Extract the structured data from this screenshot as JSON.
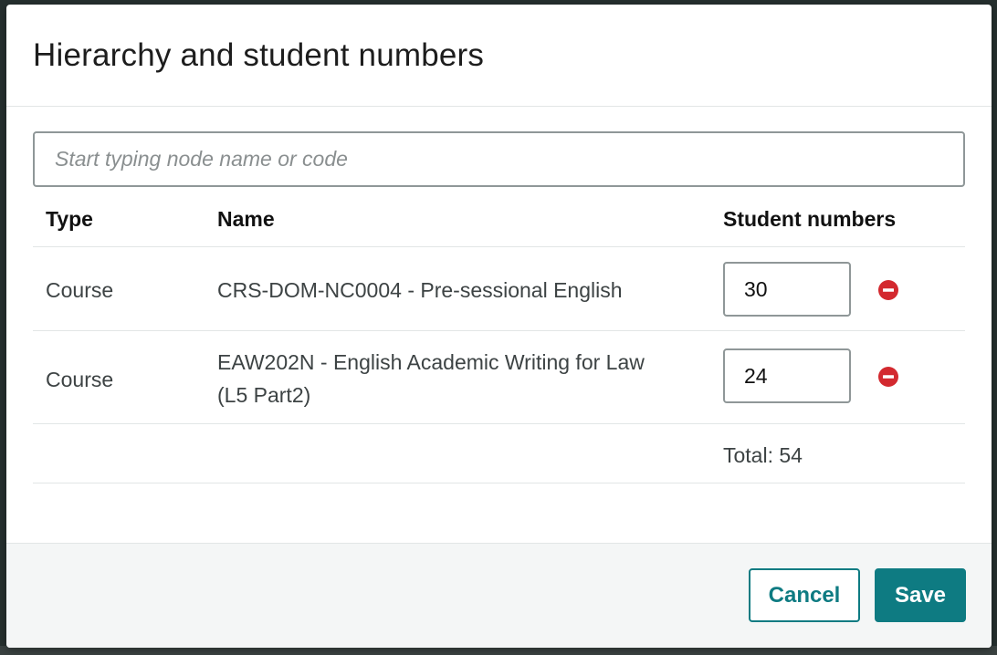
{
  "dialog": {
    "title": "Hierarchy and student numbers"
  },
  "search": {
    "placeholder": "Start typing node name or code",
    "value": ""
  },
  "table": {
    "columns": [
      "Type",
      "Name",
      "Student numbers"
    ],
    "rows": [
      {
        "type": "Course",
        "name_line1": "CRS-DOM-NC0004 - Pre-sessional English",
        "name_line2": "",
        "student_numbers": "30",
        "remove_icon": "minus-circle-icon"
      },
      {
        "type": "Course",
        "name_line1": "EAW202N - English Academic Writing for Law",
        "name_line2": "(L5 Part2)",
        "student_numbers": "24",
        "remove_icon": "minus-circle-icon"
      }
    ],
    "total_label": "Total: 54"
  },
  "footer": {
    "cancel_label": "Cancel",
    "save_label": "Save"
  },
  "colors": {
    "primary": "#0e7b82",
    "danger": "#d3292f",
    "border": "#8f9798"
  }
}
